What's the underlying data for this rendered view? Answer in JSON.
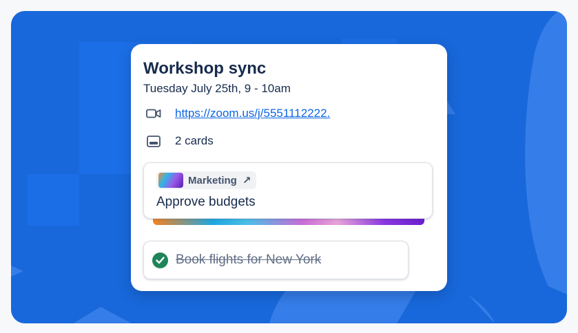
{
  "event": {
    "title": "Workshop sync",
    "datetime": "Tuesday July 25th, 9 - 10am",
    "meeting_link": "https://zoom.us/j/5551112222.",
    "cards_count": "2 cards"
  },
  "cards": [
    {
      "board": "Marketing",
      "board_arrow": "↗",
      "title": "Approve budgets",
      "completed": false
    },
    {
      "title": "Book flights for New York",
      "completed": true
    }
  ],
  "icons": {
    "meeting": "video-camera-icon",
    "cards": "card-icon",
    "board_link": "arrow-up-right-icon",
    "done": "check-circle-icon"
  },
  "colors": {
    "background": "#1868db",
    "link": "#0c66e4",
    "done_check": "#1f845a",
    "text": "#172b4d"
  }
}
